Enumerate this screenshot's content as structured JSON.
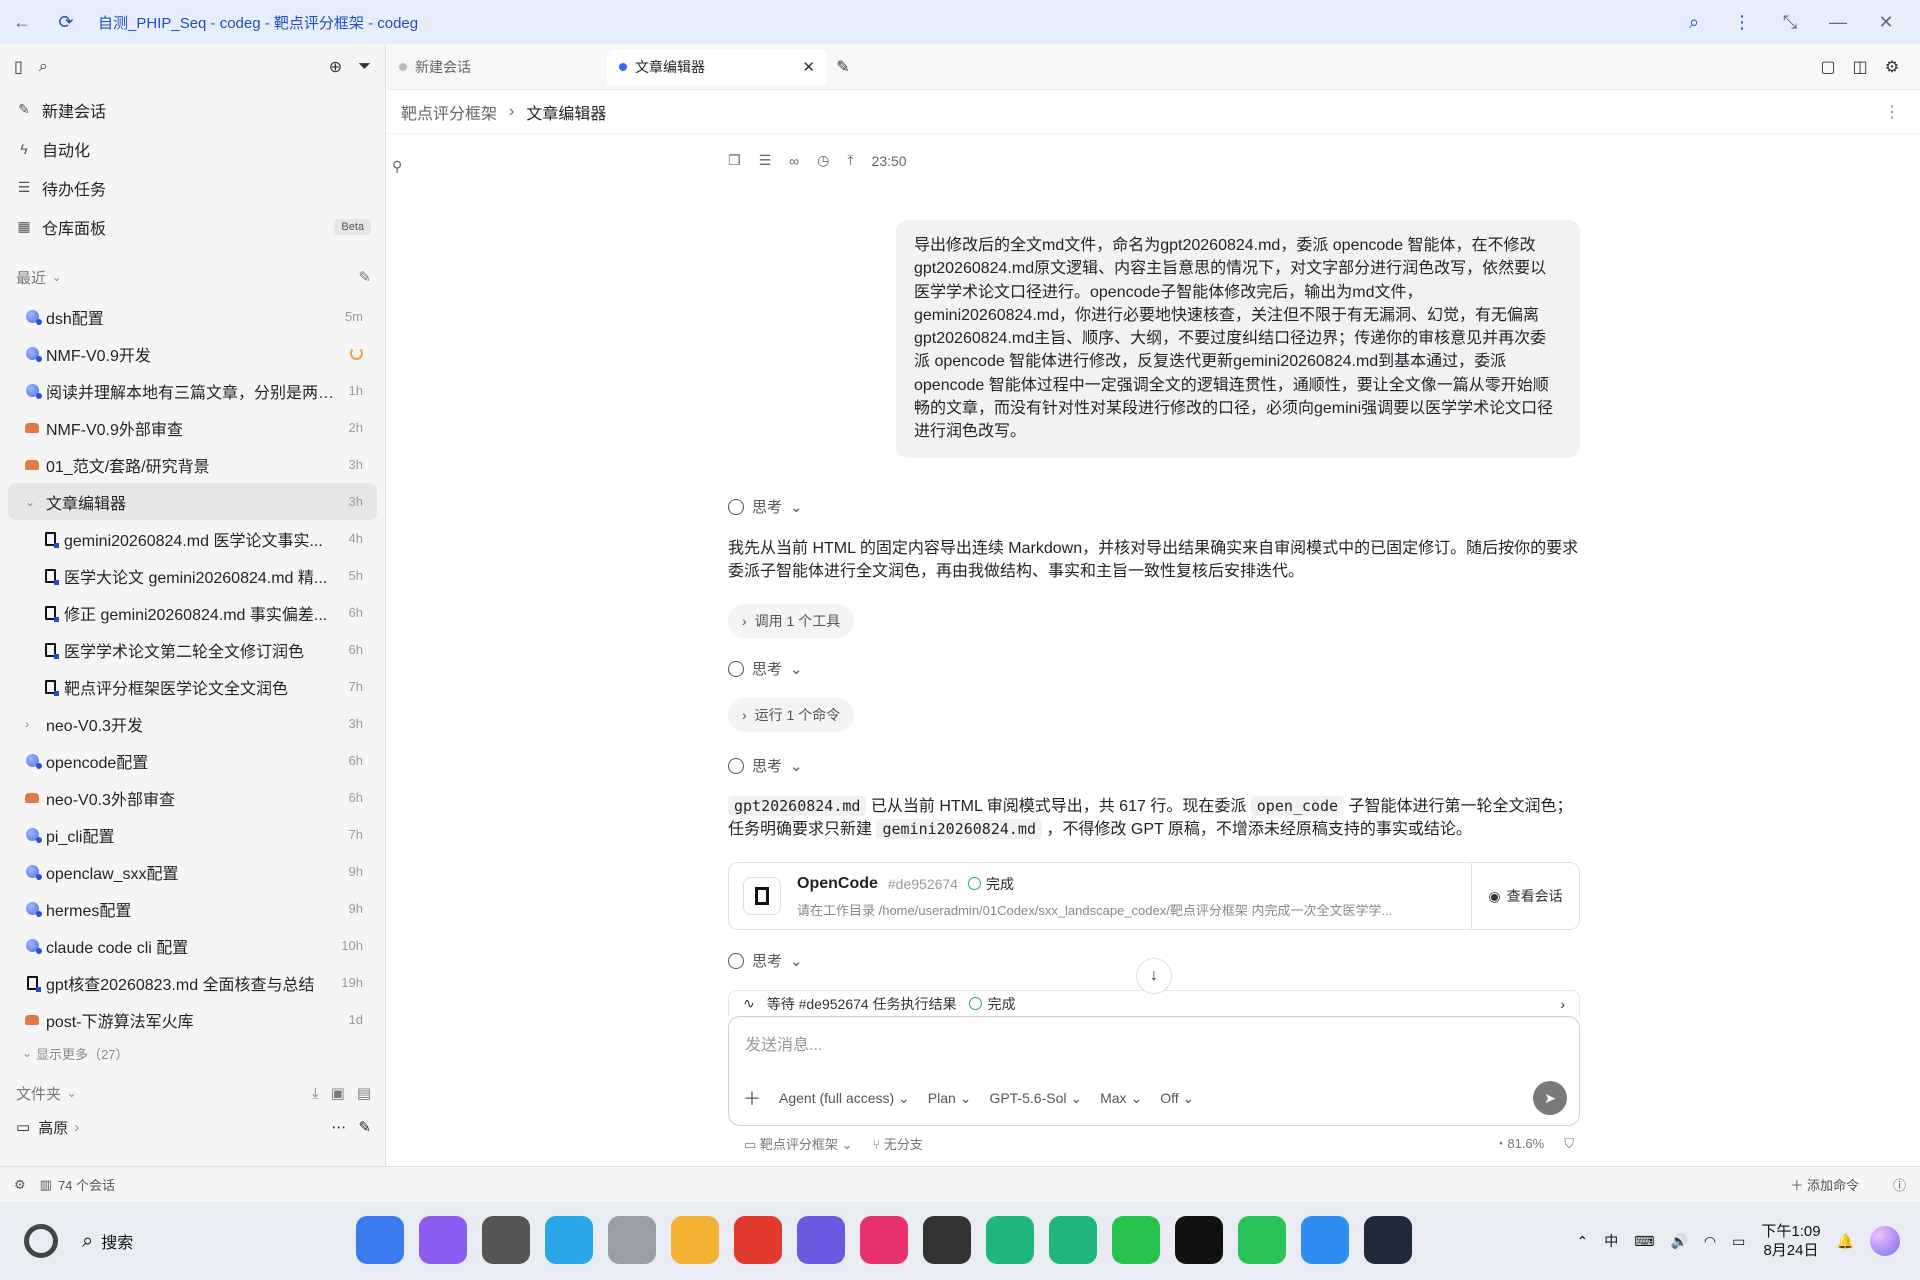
{
  "window": {
    "title": "自测_PHIP_Seq - codeg - 靶点评分框架 - codeg"
  },
  "sidebar": {
    "nav": [
      {
        "label": "新建会话",
        "icon": "edit-icon"
      },
      {
        "label": "自动化",
        "icon": "lightning-icon"
      },
      {
        "label": "待办任务",
        "icon": "checklist-icon"
      },
      {
        "label": "仓库面板",
        "icon": "board-icon",
        "badge": "Beta"
      }
    ],
    "recent_label": "最近",
    "recent": [
      {
        "label": "dsh配置",
        "time": "5m",
        "icon": "blue"
      },
      {
        "label": "NMF-V0.9开发",
        "time": "",
        "icon": "blue",
        "spinner": true
      },
      {
        "label": "阅读并理解本地有三篇文章，分别是两篇...",
        "time": "1h",
        "icon": "blue"
      },
      {
        "label": "NMF-V0.9外部审查",
        "time": "2h",
        "icon": "crab"
      },
      {
        "label": "01_范文/套路/研究背景",
        "time": "3h",
        "icon": "crab"
      },
      {
        "label": "文章编辑器",
        "time": "3h",
        "icon": "chev-down",
        "active": true
      },
      {
        "label": "gemini20260824.md 医学论文事实...",
        "time": "4h",
        "icon": "doc",
        "child": true
      },
      {
        "label": "医学大论文 gemini20260824.md 精...",
        "time": "5h",
        "icon": "doc",
        "child": true
      },
      {
        "label": "修正 gemini20260824.md 事实偏差...",
        "time": "6h",
        "icon": "doc",
        "child": true
      },
      {
        "label": "医学学术论文第二轮全文修订润色",
        "time": "6h",
        "icon": "doc",
        "child": true
      },
      {
        "label": "靶点评分框架医学论文全文润色",
        "time": "7h",
        "icon": "doc",
        "child": true
      },
      {
        "label": "neo-V0.3开发",
        "time": "3h",
        "icon": "chev-right"
      },
      {
        "label": "opencode配置",
        "time": "6h",
        "icon": "blue"
      },
      {
        "label": "neo-V0.3外部审查",
        "time": "6h",
        "icon": "crab"
      },
      {
        "label": "pi_cli配置",
        "time": "7h",
        "icon": "blue"
      },
      {
        "label": "openclaw_sxx配置",
        "time": "9h",
        "icon": "blue"
      },
      {
        "label": "hermes配置",
        "time": "9h",
        "icon": "blue"
      },
      {
        "label": "claude code cli 配置",
        "time": "10h",
        "icon": "blue"
      },
      {
        "label": "gpt核查20260823.md 全面核查与总结",
        "time": "19h",
        "icon": "doc"
      },
      {
        "label": "post-下游算法军火库",
        "time": "1d",
        "icon": "crab"
      }
    ],
    "show_more": "显示更多（27）",
    "folders_label": "文件夹",
    "folder_item": "高原"
  },
  "statusbar": {
    "sessions": "74 个会话",
    "add_command": "添加命令"
  },
  "tabs": [
    {
      "label": "新建会话",
      "active": false
    },
    {
      "label": "文章编辑器",
      "active": true
    }
  ],
  "breadcrumb": {
    "parent": "靶点评分框架",
    "current": "文章编辑器"
  },
  "chat": {
    "toolbar_time": "23:50",
    "user_message": "导出修改后的全文md文件，命名为gpt20260824.md，委派 opencode 智能体，在不修改gpt20260824.md原文逻辑、内容主旨意思的情况下，对文字部分进行润色改写，依然要以医学学术论文口径进行。opencode子智能体修改完后，输出为md文件，gemini20260824.md，你进行必要地快速核查，关注但不限于有无漏洞、幻觉，有无偏离gpt20260824.md主旨、顺序、大纲，不要过度纠结口径边界；传递你的审核意见并再次委派 opencode 智能体进行修改，反复迭代更新gemini20260824.md到基本通过，委派 opencode 智能体过程中一定强调全文的逻辑连贯性，通顺性，要让全文像一篇从零开始顺畅的文章，而没有针对性对某段进行修改的口径，必须向gemini强调要以医学学术论文口径进行润色改写。",
    "think_label": "思考",
    "assistant_para1": "我先从当前 HTML 的固定内容导出连续 Markdown，并核对导出结果确实来自审阅模式中的已固定修订。随后按你的要求委派子智能体进行全文润色，再由我做结构、事实和主旨一致性复核后安排迭代。",
    "tool_pill": "调用 1 个工具",
    "cmd_pill": "运行 1 个命令",
    "p2_code1": "gpt20260824.md",
    "p2_text1": " 已从当前 HTML 审阅模式导出，共 617 行。现在委派 ",
    "p2_code2": "open_code",
    "p2_text2": " 子智能体进行第一轮全文润色；任务明确要求只新建 ",
    "p2_code3": "gemini20260824.md",
    "p2_text3": " ，不得修改 GPT 原稿，不增添未经原稿支持的事实或结论。",
    "agent": {
      "name": "OpenCode",
      "id": "#de952674",
      "status": "完成",
      "desc": "请在工作目录 /home/useradmin/01Codex/sxx_landscape_codex/靶点评分框架 内完成一次全文医学学...",
      "view": "查看会话"
    },
    "wait_text": "等待 #de952674 任务执行结果",
    "wait_status": "完成"
  },
  "composer": {
    "placeholder": "发送消息...",
    "mode": "Agent (full access)",
    "plan": "Plan",
    "model": "GPT-5.6-Sol",
    "effort": "Max",
    "toggle": "Off",
    "project": "靶点评分框架",
    "branch": "无分支",
    "context": "81.6%"
  },
  "taskbar": {
    "search": "搜索",
    "ime": "中",
    "time": "下午1:09",
    "date": "8月24日",
    "apps": [
      "#3a7bef",
      "#8a5cf0",
      "#555",
      "#2aa6e8",
      "#9aa0a6",
      "#f2b233",
      "#e23b2e",
      "#6a5ae0",
      "#e8326f",
      "#333",
      "#1fb87a",
      "#1fb87a",
      "#27c24c",
      "#111",
      "#2ac35a",
      "#2f8cf0",
      "#1e2a3a"
    ]
  }
}
